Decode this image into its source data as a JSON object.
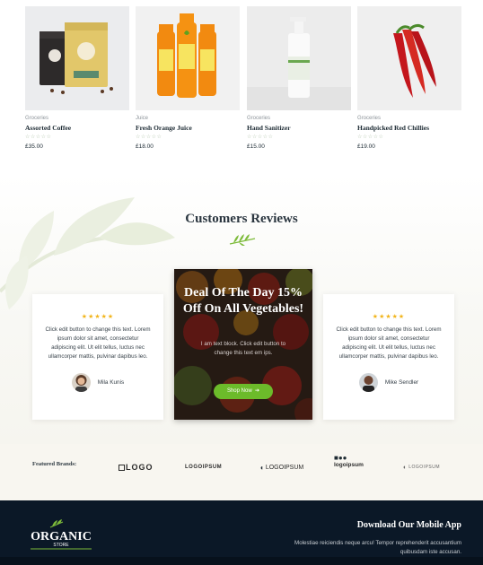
{
  "products": [
    {
      "category": "Groceries",
      "name": "Assorted Coffee",
      "rating_stars": "☆☆☆☆☆",
      "price": "£35.00",
      "image": "coffee-bags"
    },
    {
      "category": "Juice",
      "name": "Fresh Orange Juice",
      "rating_stars": "☆☆☆☆☆",
      "price": "£18.00",
      "image": "orange-juice-bottles"
    },
    {
      "category": "Groceries",
      "name": "Hand Sanitizer",
      "rating_stars": "☆☆☆☆☆",
      "price": "£15.00",
      "image": "sanitizer-bottle"
    },
    {
      "category": "Groceries",
      "name": "Handpicked Red Chillies",
      "rating_stars": "☆☆☆☆☆",
      "price": "£19.00",
      "image": "red-chillies"
    }
  ],
  "reviews": {
    "title": "Customers Reviews",
    "cards": [
      {
        "stars": "★★★★★",
        "text": "Click edit button to change this text. Lorem ipsum dolor sit amet, consectetur adipiscing elit. Ut elit tellus, luctus nec ullamcorper mattis, pulvinar dapibus leo.",
        "author": "Mila Kunis"
      },
      {
        "stars": "★★★★★",
        "text": "Click edit button to change this text. Lorem ipsum dolor sit amet, consectetur adipiscing elit. Ut elit tellus, luctus nec ullamcorper mattis, pulvinar dapibus leo.",
        "author": "Mike Sendler"
      }
    ],
    "promo": {
      "title": "Deal Of The Day 15% Off On All Vegetables!",
      "text": "I am text block. Click edit button to change this text em ips.",
      "button": "Shop Now"
    }
  },
  "brands": {
    "label": "Featured Brands:",
    "logos": [
      "LOGO",
      "LOGOIPSUM",
      "LOGOIPSUM",
      "logoipsum",
      "LOGOIPSUM"
    ]
  },
  "footer": {
    "logo_word": "ORGANIC",
    "logo_sub": "STORE",
    "app_title": "Download Our Mobile App",
    "app_text": "Molestiae reiciendis neque arcu! Tempor reprehenderit accusantium quibusdam iste accusan."
  },
  "colors": {
    "accent_green": "#6cbb2a",
    "star_gold": "#f2b51c",
    "footer_navy": "#0b1827"
  }
}
